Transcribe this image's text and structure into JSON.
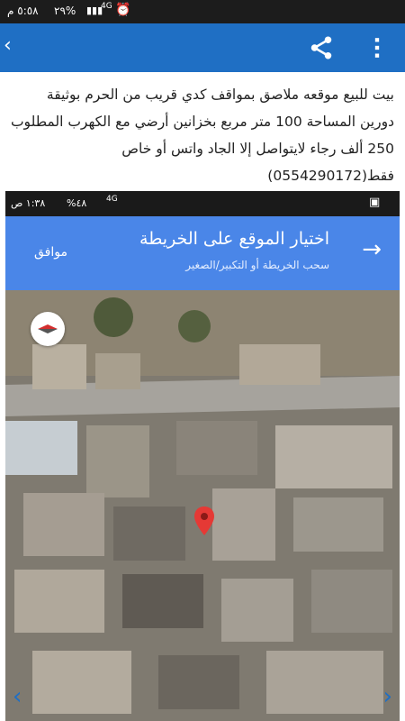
{
  "status_bar": {
    "time": "٥:٥٨ م",
    "battery": "%٢٩",
    "network": "4G",
    "icons": [
      "signal-icon",
      "alarm-icon",
      "battery-icon"
    ]
  },
  "app_bar": {
    "back_icon": "back-chevron-icon",
    "share_icon": "share-icon",
    "more_icon": "more-vert-icon",
    "color": "#1f6fc4"
  },
  "description": "بيت للبيع موقعه ملاصق بمواقف كدي قريب من الحرم بوثيقة دورين المساحة 100 متر مربع بخزانين أرضي مع الكهرب المطلوب 250 ألف رجاء لايتواصل إلا الجاد واتس أو خاص فقط(0554290172)",
  "screenshot": {
    "status_bar": {
      "time": "١:٣٨ ص",
      "battery": "%٤٨",
      "network": "4G"
    },
    "map_picker": {
      "title": "اختيار الموقع على الخريطة",
      "subtitle": "سحب الخريطة أو التكبير/الصغير",
      "confirm_label": "موافق",
      "forward_icon": "arrow-right-icon",
      "bar_color": "#4a86e8"
    },
    "compass_icon": "compass-icon",
    "pin_icon": "map-pin-icon"
  },
  "nav": {
    "prev_icon": "chevron-left-icon",
    "next_icon": "chevron-right-icon"
  }
}
